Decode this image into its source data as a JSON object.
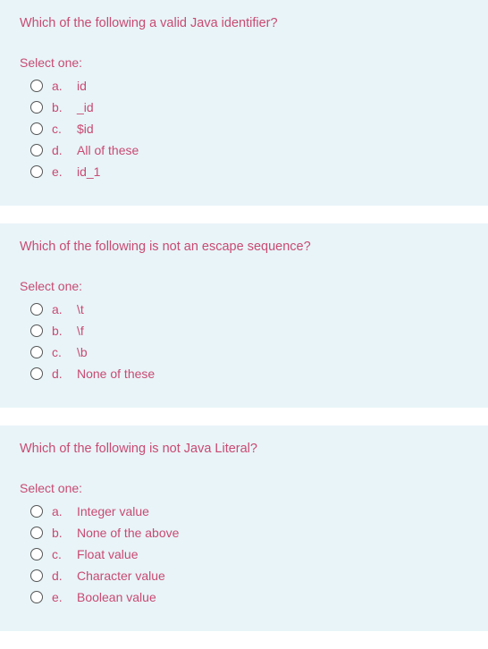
{
  "questions": [
    {
      "text": "Which of the following a valid Java identifier?",
      "prompt": "Select one:",
      "options": [
        {
          "letter": "a.",
          "text": "id"
        },
        {
          "letter": "b.",
          "text": "_id"
        },
        {
          "letter": "c.",
          "text": "$id"
        },
        {
          "letter": "d.",
          "text": "All of these"
        },
        {
          "letter": "e.",
          "text": "id_1"
        }
      ]
    },
    {
      "text": "Which of the following is not an escape sequence?",
      "prompt": "Select one:",
      "options": [
        {
          "letter": "a.",
          "text": "\\t"
        },
        {
          "letter": "b.",
          "text": "\\f"
        },
        {
          "letter": "c.",
          "text": "\\b"
        },
        {
          "letter": "d.",
          "text": "None of these"
        }
      ]
    },
    {
      "text": "Which of the following is not Java Literal?",
      "prompt": "Select one:",
      "options": [
        {
          "letter": "a.",
          "text": "Integer value"
        },
        {
          "letter": "b.",
          "text": "None of the above"
        },
        {
          "letter": "c.",
          "text": "Float value"
        },
        {
          "letter": "d.",
          "text": "Character value"
        },
        {
          "letter": "e.",
          "text": "Boolean value"
        }
      ]
    }
  ]
}
